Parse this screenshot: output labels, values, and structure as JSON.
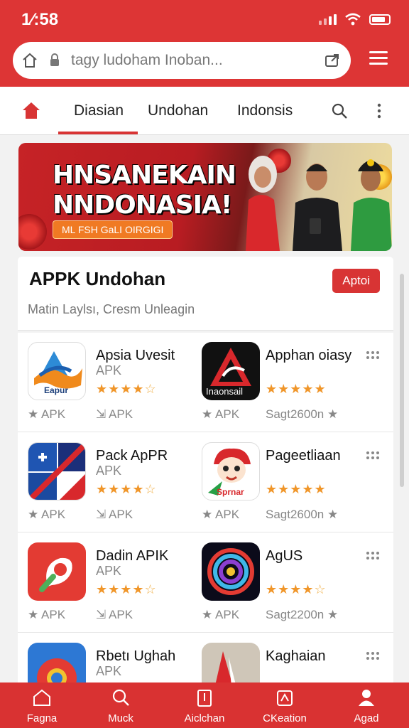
{
  "status": {
    "time": "1⁄:58"
  },
  "browser": {
    "url": "tagy ludoham Inoban..."
  },
  "nav": {
    "tabs": [
      "Diasian",
      "Undohan",
      "Indonsis"
    ]
  },
  "banner": {
    "title_line1": "HNSANEKAIN",
    "title_line2": "NNDONASIA!",
    "pill": "ML FSH GaLI OIRGIGI"
  },
  "section": {
    "title": "APPK Undohan",
    "subtitle": "Matin Laylsı, Cresm Unleagin",
    "button": "Aptoi"
  },
  "apps": [
    {
      "name": "Apsia Uvesit",
      "type": "APK",
      "rating": 4.5,
      "meta1": "APK",
      "meta2": "APK",
      "icon_label": "Eapur",
      "icon": "blue-wave-icon"
    },
    {
      "name": "Apphan oiasy",
      "type": "",
      "rating": 5,
      "meta1": "APK",
      "meta2": "Sagt2600n",
      "icon_label": "Inaonsail",
      "icon": "red-triangle-icon"
    },
    {
      "name": "Pack ApPR",
      "type": "APK",
      "rating": 4.5,
      "meta1": "APK",
      "meta2": "APK",
      "icon_label": "",
      "icon": "flag-collage-icon"
    },
    {
      "name": "Pageetliaan",
      "type": "",
      "rating": 5,
      "meta1": "APK",
      "meta2": "Sagt2600n",
      "icon_label": "Sprnar",
      "icon": "mascot-icon"
    },
    {
      "name": "Dadin APIK",
      "type": "APK",
      "rating": 4.5,
      "meta1": "APK",
      "meta2": "APK",
      "icon_label": "",
      "icon": "red-pin-icon"
    },
    {
      "name": "AgUS",
      "type": "",
      "rating": 4.5,
      "meta1": "APK",
      "meta2": "Sagt2200n",
      "icon_label": "",
      "icon": "spiral-icon"
    },
    {
      "name": "Rbetı Ughah",
      "type": "APK",
      "rating": 0,
      "meta1": "",
      "meta2": "",
      "icon_label": "",
      "icon": "chrome-like-icon"
    },
    {
      "name": "Kaghaian",
      "type": "",
      "rating": 0,
      "meta1": "",
      "meta2": "",
      "icon_label": "",
      "icon": "flag-icon"
    }
  ],
  "bottom_nav": [
    "Fagna",
    "Muck",
    "Aiclchan",
    "CKeation",
    "Agad"
  ],
  "colors": {
    "accent": "#d83434",
    "star": "#f0962a"
  }
}
